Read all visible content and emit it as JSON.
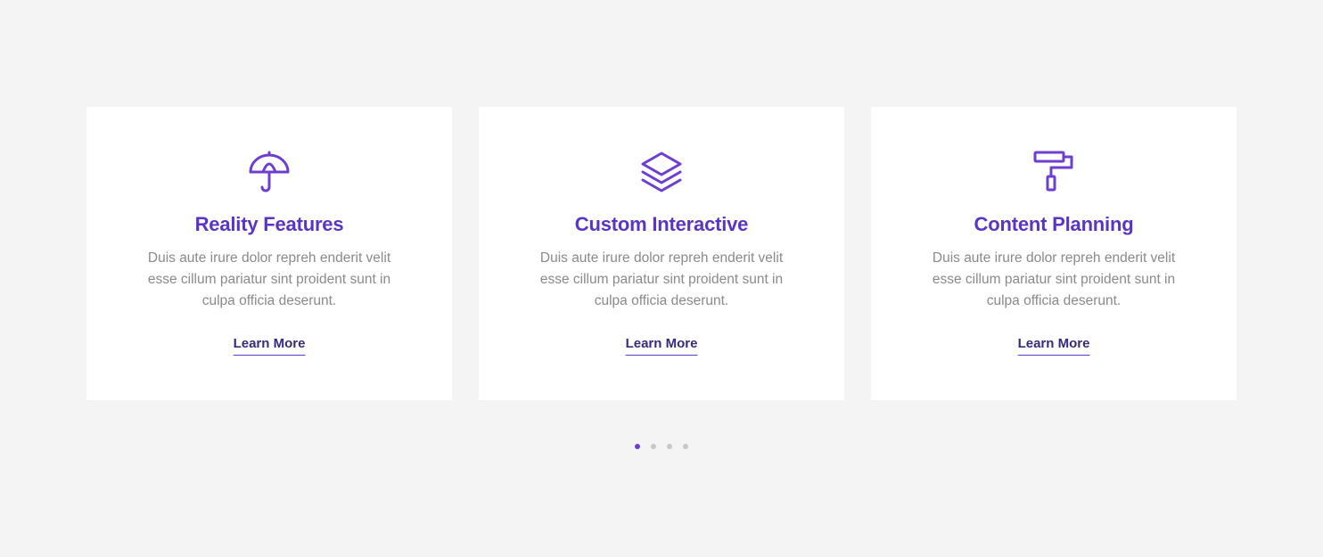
{
  "colors": {
    "accent": "#6c3fd0",
    "title": "#5a35c4",
    "body_text": "#8a8a8a",
    "card_bg": "#ffffff",
    "page_bg": "#f4f4f4",
    "dot_inactive": "#c8c8c8"
  },
  "cards": [
    {
      "icon": "umbrella-icon",
      "title": "Reality Features",
      "description": "Duis aute irure dolor repreh enderit velit esse cillum pariatur sint proident sunt in culpa officia deserunt.",
      "link_label": "Learn More"
    },
    {
      "icon": "layers-icon",
      "title": "Custom Interactive",
      "description": "Duis aute irure dolor repreh enderit velit esse cillum pariatur sint proident sunt in culpa officia deserunt.",
      "link_label": "Learn More"
    },
    {
      "icon": "paint-roller-icon",
      "title": "Content Planning",
      "description": "Duis aute irure dolor repreh enderit velit esse cillum pariatur sint proident sunt in culpa officia deserunt.",
      "link_label": "Learn More"
    }
  ],
  "pagination": {
    "count": 4,
    "active_index": 0
  }
}
